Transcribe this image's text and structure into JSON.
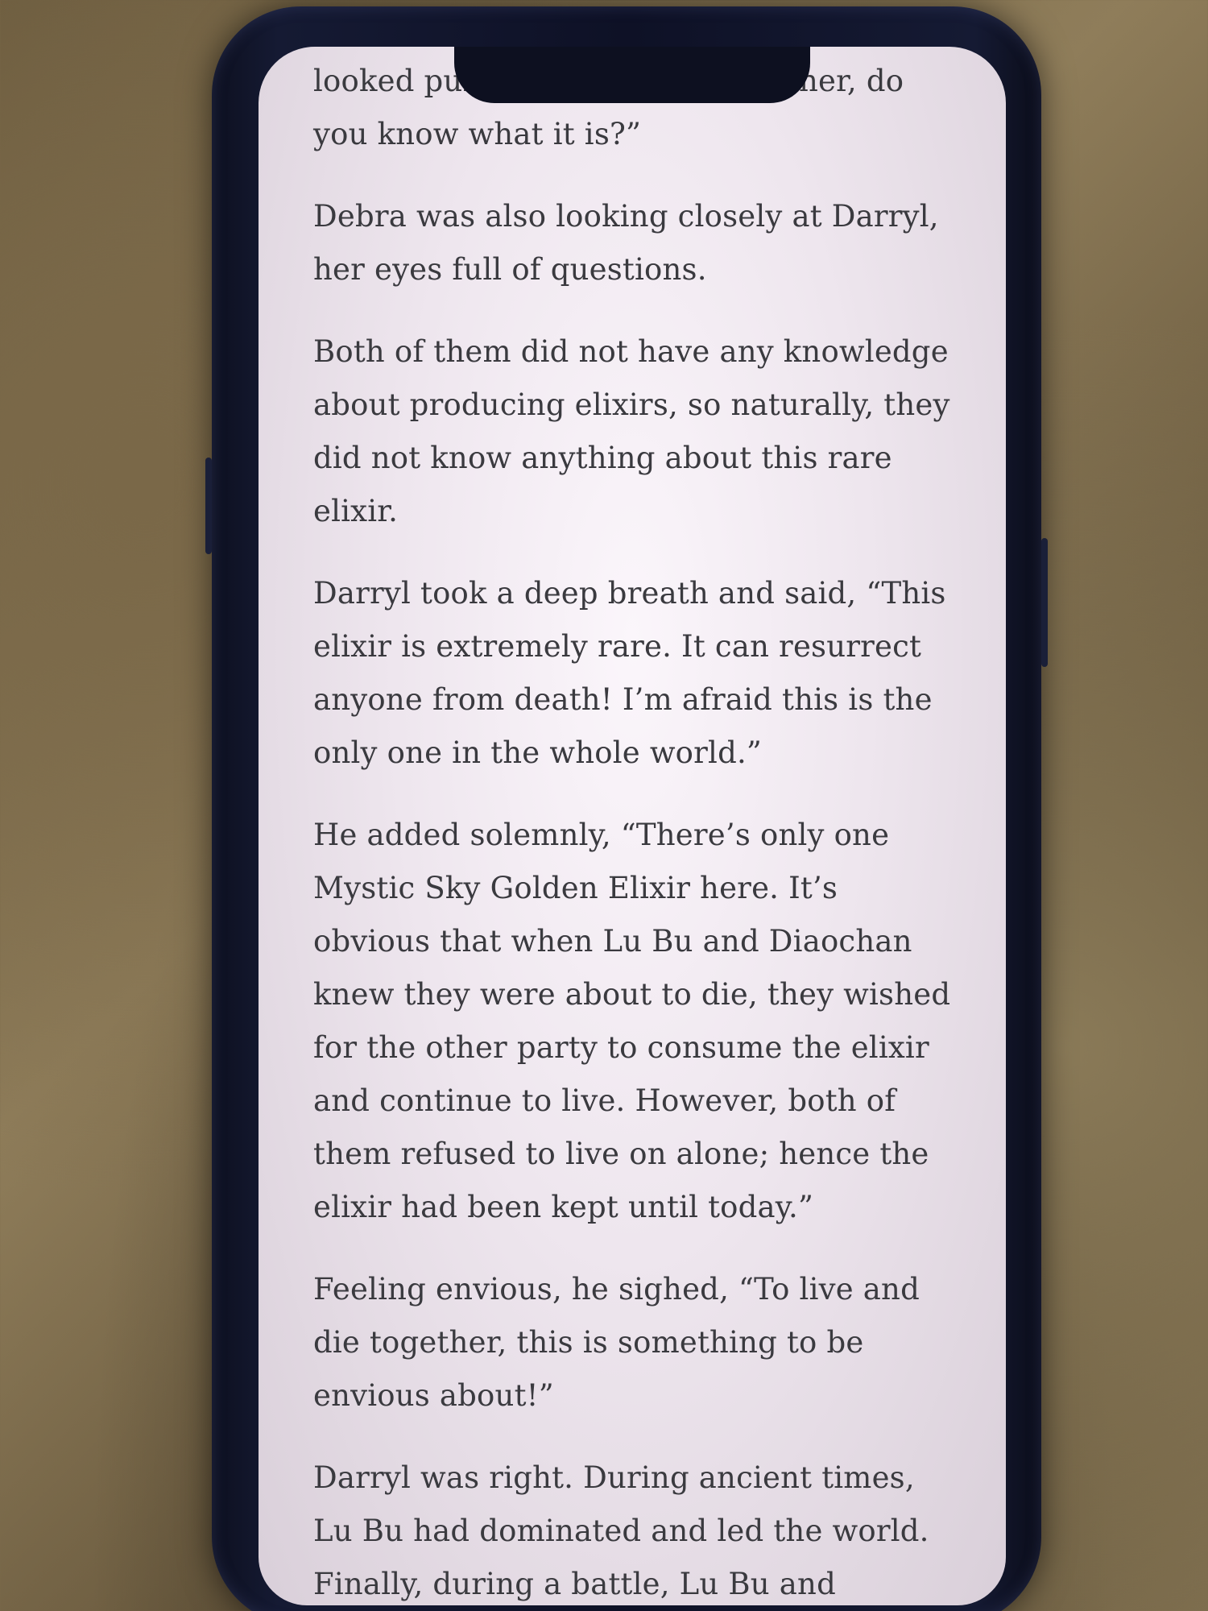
{
  "reader": {
    "paragraphs": [
      "looked puzzled at Darryl. “ Brother, do you know what it is?”",
      "Debra was also looking closely at Darryl, her eyes full of questions.",
      "Both of them did not have any knowledge about producing elixirs, so naturally, they did not know anything about this rare elixir.",
      "Darryl took a deep breath and said, “This elixir is extremely rare. It can resurrect anyone from death! I’m afraid this is the only one in the whole world.”",
      "He added solemnly, “There’s only one Mystic Sky Golden Elixir here. It’s obvious that when Lu Bu and Diaochan knew they were about to die, they wished for the other party to consume the elixir and continue to live. However, both of them refused to live on alone; hence the elixir had been kept until today.”",
      "Feeling envious, he sighed, “To live and die together, this is something to be envious about!”",
      "Darryl was right. During ancient times, Lu Bu had dominated and led the world. Finally, during a battle, Lu Bu and"
    ]
  }
}
